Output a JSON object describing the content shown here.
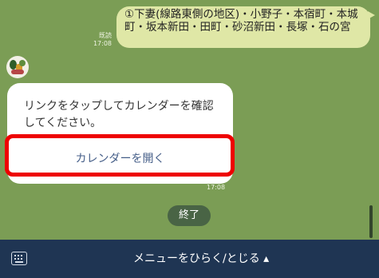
{
  "messages": {
    "outgoing": {
      "text": "①下妻(線路東側の地区)・小野子・本宿町・本城町・坂本新田・田町・砂沼新田・長塚・石の宮",
      "status": "既読",
      "time": "17:08"
    },
    "incoming": {
      "text": "リンクをタップしてカレンダーを確認してください。",
      "link_label": "カレンダーを開く",
      "time": "17:08"
    },
    "quick_reply": "終了"
  },
  "menu": {
    "label": "メニューをひらく/とじる ▴",
    "keyboard_icon": "keyboard-icon"
  }
}
